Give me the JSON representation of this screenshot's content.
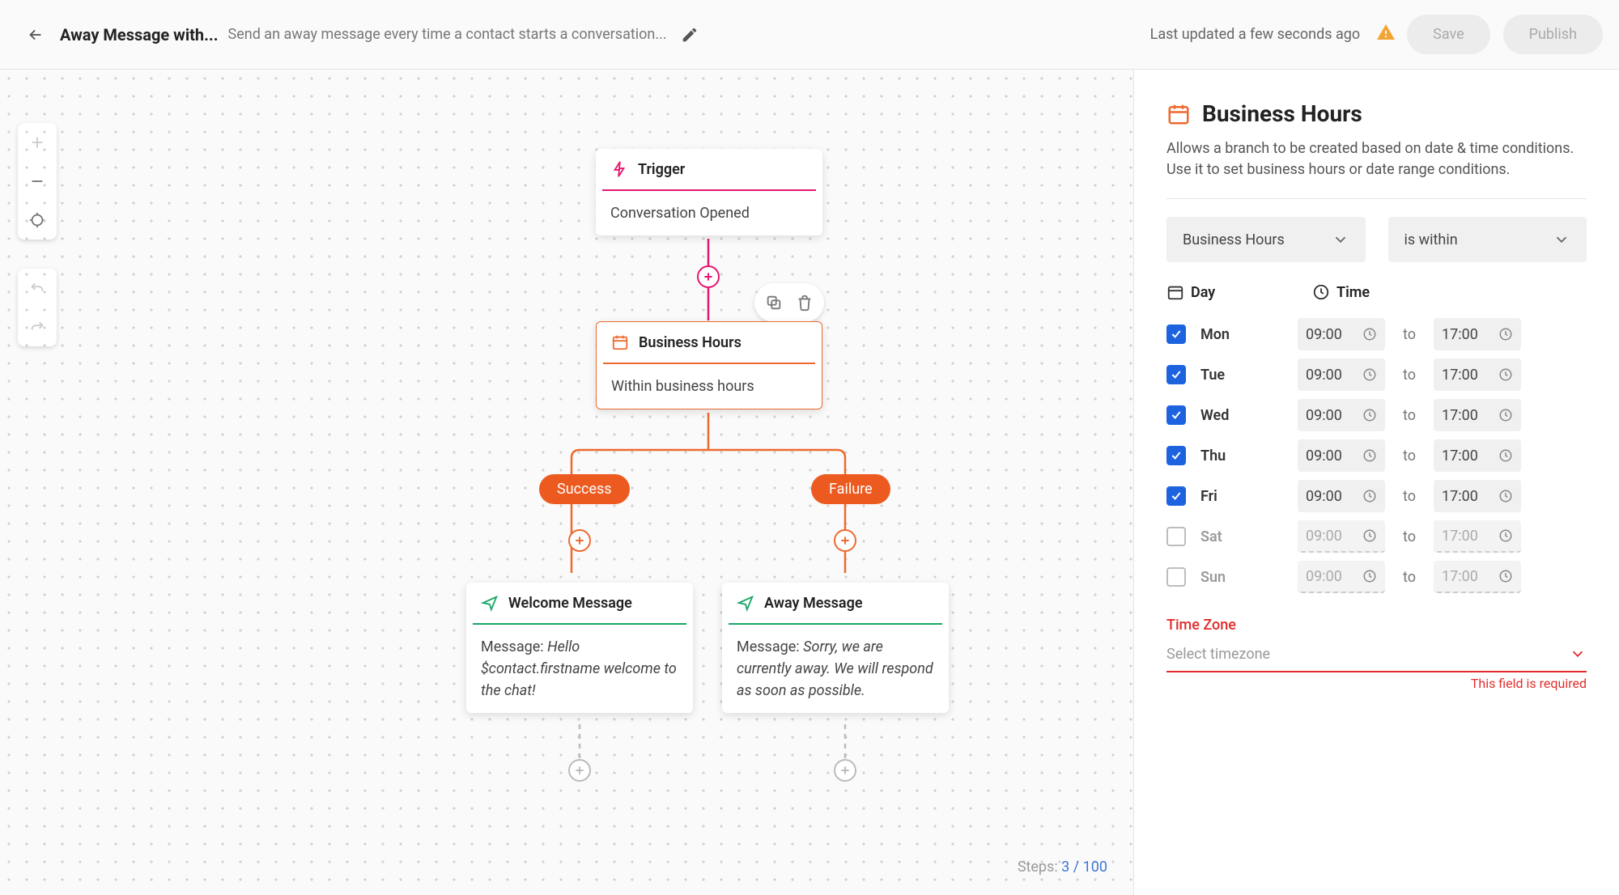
{
  "header": {
    "title": "Away Message with...",
    "description": "Send an away message every time a contact starts a conversation...",
    "last_updated": "Last updated a few seconds ago",
    "save_label": "Save",
    "publish_label": "Publish"
  },
  "canvas": {
    "steps_label": "Steps:",
    "steps_count": "3 / 100",
    "nodes": {
      "trigger": {
        "title": "Trigger",
        "body": "Conversation Opened"
      },
      "business_hours": {
        "title": "Business Hours",
        "body": "Within business hours"
      },
      "welcome": {
        "title": "Welcome Message",
        "prefix": "Message: ",
        "body": "Hello $contact.firstname welcome to the chat!"
      },
      "away": {
        "title": "Away Message",
        "prefix": "Message: ",
        "body": "Sorry, we are currently away. We will respond as soon as possible."
      }
    },
    "pills": {
      "success": "Success",
      "failure": "Failure"
    }
  },
  "panel": {
    "title": "Business Hours",
    "description": "Allows a branch to be created based on date & time conditions. Use it to set business hours or date range conditions.",
    "select_type": "Business Hours",
    "select_condition": "is within",
    "schedule_headers": {
      "day": "Day",
      "time": "Time"
    },
    "to_label": "to",
    "days": [
      {
        "label": "Mon",
        "enabled": true,
        "start": "09:00",
        "end": "17:00"
      },
      {
        "label": "Tue",
        "enabled": true,
        "start": "09:00",
        "end": "17:00"
      },
      {
        "label": "Wed",
        "enabled": true,
        "start": "09:00",
        "end": "17:00"
      },
      {
        "label": "Thu",
        "enabled": true,
        "start": "09:00",
        "end": "17:00"
      },
      {
        "label": "Fri",
        "enabled": true,
        "start": "09:00",
        "end": "17:00"
      },
      {
        "label": "Sat",
        "enabled": false,
        "start": "09:00",
        "end": "17:00"
      },
      {
        "label": "Sun",
        "enabled": false,
        "start": "09:00",
        "end": "17:00"
      }
    ],
    "timezone": {
      "label": "Time Zone",
      "placeholder": "Select timezone",
      "error": "This field is required"
    }
  }
}
